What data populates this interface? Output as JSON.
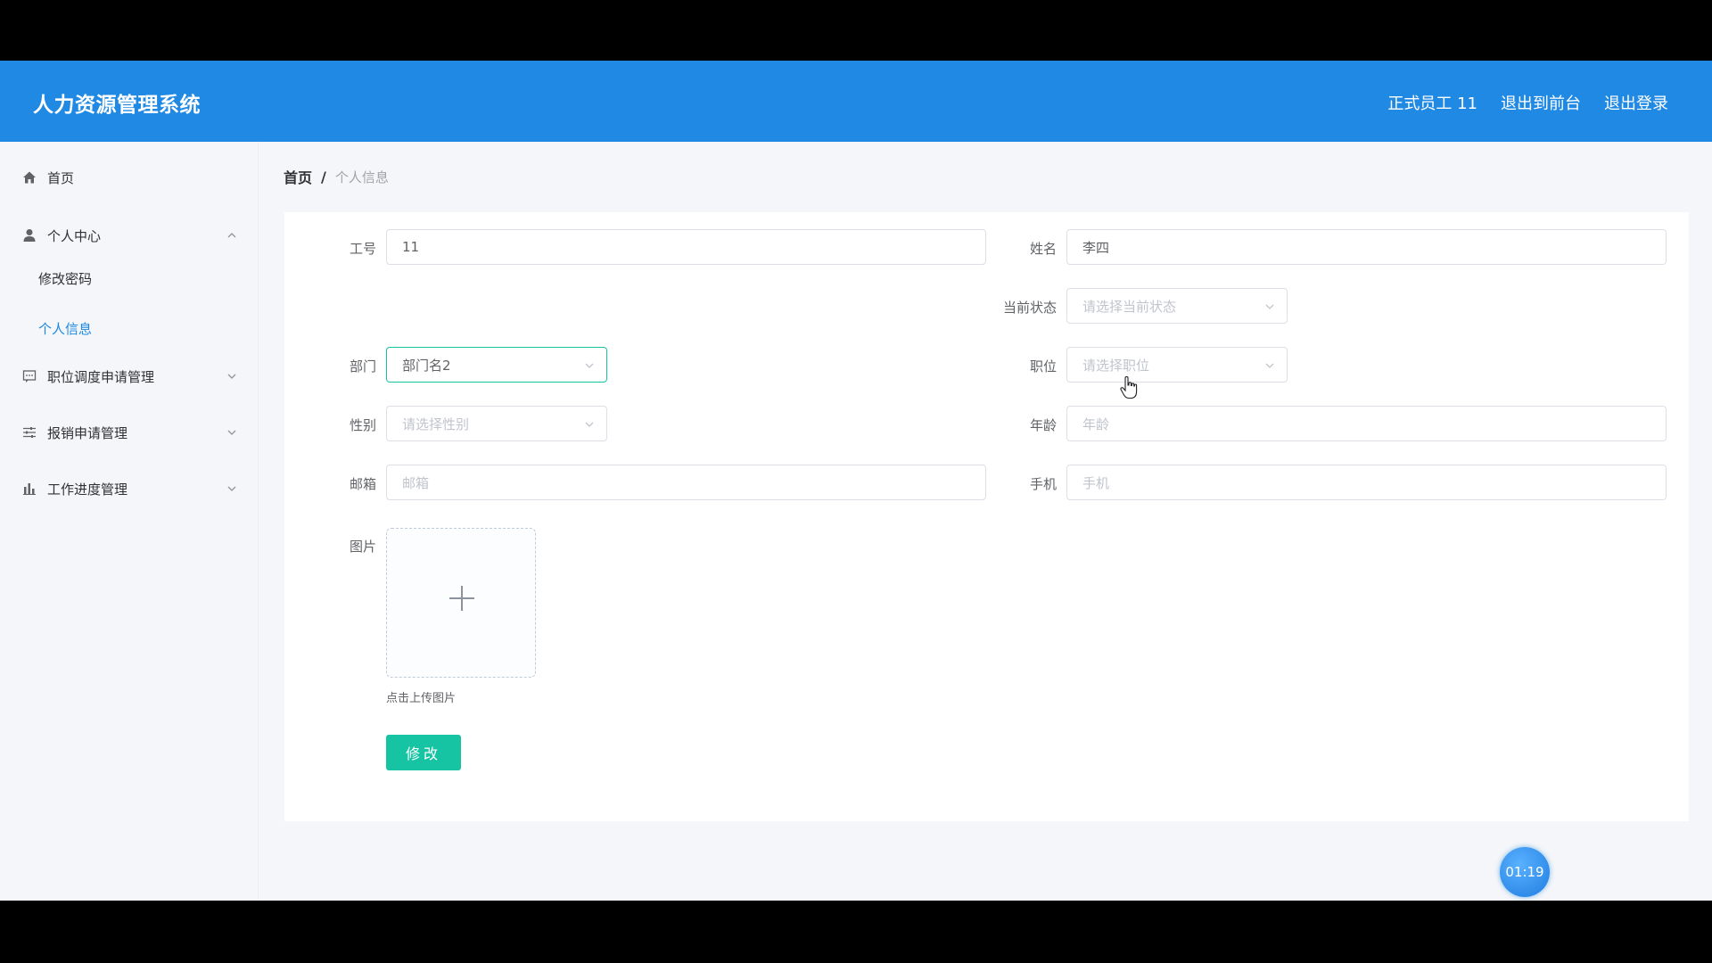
{
  "header": {
    "title": "人力资源管理系统",
    "user": "正式员工 11",
    "to_front": "退出到前台",
    "logout": "退出登录"
  },
  "sidebar": {
    "home": "首页",
    "personal_center": "个人中心",
    "change_password": "修改密码",
    "personal_info": "个人信息",
    "transfer_mgmt": "职位调度申请管理",
    "reimburse_mgmt": "报销申请管理",
    "progress_mgmt": "工作进度管理"
  },
  "breadcrumb": {
    "home": "首页",
    "separator": "/",
    "current": "个人信息"
  },
  "form": {
    "emp_no_label": "工号",
    "emp_no_value": "11",
    "name_label": "姓名",
    "name_value": "李四",
    "status_label": "当前状态",
    "status_placeholder": "请选择当前状态",
    "dept_label": "部门",
    "dept_value": "部门名2",
    "position_label": "职位",
    "position_placeholder": "请选择职位",
    "gender_label": "性别",
    "gender_placeholder": "请选择性别",
    "age_label": "年龄",
    "age_placeholder": "年龄",
    "email_label": "邮箱",
    "email_placeholder": "邮箱",
    "phone_label": "手机",
    "phone_placeholder": "手机",
    "image_label": "图片",
    "upload_tip": "点击上传图片",
    "submit": "修改"
  },
  "timer": "01:19",
  "colors": {
    "header": "#2089e3",
    "accent": "#16c4a3",
    "active_menu": "#2089e3"
  }
}
